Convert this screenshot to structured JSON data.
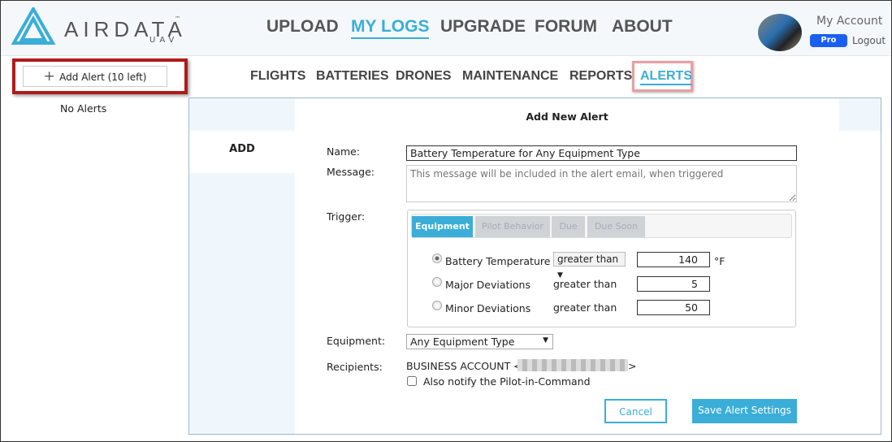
{
  "brand": {
    "name": "AIRDATA",
    "sub": "UAV",
    "tm": "™"
  },
  "nav": [
    "UPLOAD",
    "MY LOGS",
    "UPGRADE",
    "FORUM",
    "ABOUT"
  ],
  "account": {
    "label": "My Account",
    "badge": "Pro",
    "logout": "Logout"
  },
  "sidebar": {
    "add_button": "Add Alert (10 left)",
    "empty": "No Alerts"
  },
  "subnav": [
    "FLIGHTS",
    "BATTERIES",
    "DRONES",
    "MAINTENANCE",
    "REPORTS",
    "ALERTS"
  ],
  "panel": {
    "title": "Add New Alert",
    "side_tab": "ADD"
  },
  "form": {
    "name_label": "Name:",
    "name_value": "Battery Temperature for Any Equipment Type",
    "message_label": "Message:",
    "message_placeholder": "This message will be included in the alert email, when triggered",
    "trigger_label": "Trigger:",
    "tabs": [
      "Equipment",
      "Pilot Behavior",
      "Due",
      "Due Soon"
    ],
    "triggers": [
      {
        "label": "Battery Temperature",
        "op": "greater than",
        "value": "140",
        "unit": "°F",
        "selected": true
      },
      {
        "label": "Major Deviations",
        "op": "greater than",
        "value": "5",
        "unit": "",
        "selected": false
      },
      {
        "label": "Minor Deviations",
        "op": "greater than",
        "value": "50",
        "unit": "",
        "selected": false
      }
    ],
    "equipment_label": "Equipment:",
    "equipment_value": "Any Equipment Type",
    "recipients_label": "Recipients:",
    "recipients_value": "BUSINESS ACCOUNT <",
    "recipients_end": ">",
    "notify_label": "Also notify the Pilot-in-Command",
    "cancel": "Cancel",
    "save": "Save Alert Settings"
  },
  "colors": {
    "accent": "#3aaed8",
    "highlight": "#b01a1a",
    "pro": "#1a5ff0"
  }
}
